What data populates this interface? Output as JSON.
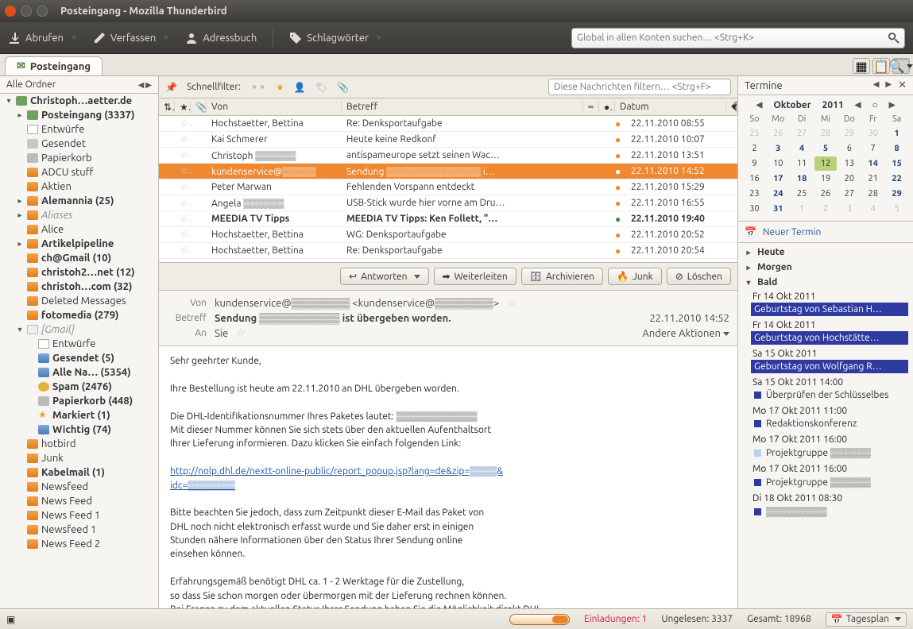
{
  "window": {
    "title": "Posteingang - Mozilla Thunderbird"
  },
  "toolbar": {
    "get": "Abrufen",
    "compose": "Verfassen",
    "addressbook": "Adressbuch",
    "tags": "Schlagwörter",
    "search_ph": "Global in allen Konten suchen… <Strg+K>"
  },
  "tab": {
    "inbox": "Posteingang"
  },
  "sidebar": {
    "header": "Alle Ordner",
    "nodes": [
      {
        "tw": "▾",
        "ico": "inbox",
        "label": "Christoph…aetter.de",
        "bold": true,
        "lvl": 0
      },
      {
        "tw": "▸",
        "ico": "inbox",
        "label": "Posteingang (3337)",
        "bold": true,
        "lvl": 1
      },
      {
        "tw": "",
        "ico": "page",
        "label": "Entwürfe",
        "lvl": 1
      },
      {
        "tw": "",
        "ico": "sent",
        "label": "Gesendet",
        "lvl": 1
      },
      {
        "tw": "",
        "ico": "trash",
        "label": "Papierkorb",
        "lvl": 1
      },
      {
        "tw": "",
        "ico": "folder",
        "label": "ADCU stuff",
        "lvl": 1
      },
      {
        "tw": "",
        "ico": "folder",
        "label": "Aktien",
        "lvl": 1
      },
      {
        "tw": "▸",
        "ico": "folder",
        "label": "Alemannia (25)",
        "bold": true,
        "lvl": 1
      },
      {
        "tw": "▸",
        "ico": "folder",
        "label": "Aliases",
        "grey": true,
        "lvl": 1
      },
      {
        "tw": "",
        "ico": "folder",
        "label": "Alice",
        "lvl": 1
      },
      {
        "tw": "▸",
        "ico": "folder",
        "label": "Artikelpipeline",
        "bold": true,
        "lvl": 1
      },
      {
        "tw": "",
        "ico": "folder",
        "label": "ch@Gmail (10)",
        "bold": true,
        "lvl": 1
      },
      {
        "tw": "",
        "ico": "folder",
        "label": "christoh2…net (12)",
        "bold": true,
        "lvl": 1
      },
      {
        "tw": "",
        "ico": "folder",
        "label": "christoh…com (32)",
        "bold": true,
        "lvl": 1
      },
      {
        "tw": "",
        "ico": "folder",
        "label": "Deleted Messages",
        "lvl": 1
      },
      {
        "tw": "",
        "ico": "folder",
        "label": "fotomedia (279)",
        "bold": true,
        "lvl": 1
      },
      {
        "tw": "▾",
        "ico": "gmail",
        "label": "[Gmail]",
        "grey": true,
        "lvl": 1
      },
      {
        "tw": "",
        "ico": "page",
        "label": "Entwürfe",
        "lvl": 2
      },
      {
        "tw": "",
        "ico": "folder-b",
        "label": "Gesendet (5)",
        "bold": true,
        "lvl": 2
      },
      {
        "tw": "",
        "ico": "folder-b",
        "label": "Alle Na… (5354)",
        "bold": true,
        "lvl": 2
      },
      {
        "tw": "",
        "ico": "spam",
        "label": "Spam (2476)",
        "bold": true,
        "lvl": 2
      },
      {
        "tw": "",
        "ico": "trash",
        "label": "Papierkorb (448)",
        "bold": true,
        "lvl": 2
      },
      {
        "tw": "",
        "ico": "star",
        "label": "Markiert (1)",
        "bold": true,
        "lvl": 2
      },
      {
        "tw": "",
        "ico": "folder-b",
        "label": "Wichtig (74)",
        "bold": true,
        "lvl": 2
      },
      {
        "tw": "",
        "ico": "folder",
        "label": "hotbird",
        "lvl": 1
      },
      {
        "tw": "",
        "ico": "folder",
        "label": "Junk",
        "lvl": 1
      },
      {
        "tw": "",
        "ico": "folder",
        "label": "Kabelmail (1)",
        "bold": true,
        "lvl": 1
      },
      {
        "tw": "",
        "ico": "folder",
        "label": "Newsfeed",
        "lvl": 1
      },
      {
        "tw": "",
        "ico": "folder",
        "label": "News Feed",
        "lvl": 1
      },
      {
        "tw": "",
        "ico": "folder",
        "label": "News Feed 1",
        "lvl": 1
      },
      {
        "tw": "",
        "ico": "folder",
        "label": "Newsfeed 1",
        "lvl": 1
      },
      {
        "tw": "",
        "ico": "folder",
        "label": "News Feed 2",
        "lvl": 1
      }
    ]
  },
  "qfilter": {
    "label": "Schnellfilter:",
    "ph": "Diese Nachrichten filtern… <Strg+F>"
  },
  "columns": {
    "from": "Von",
    "subject": "Betreff",
    "date": "Datum"
  },
  "messages": [
    {
      "from": "Hochstaetter, Bettina",
      "subj": "Re: Denksportaufgabe",
      "date": "22.11.2010 08:55",
      "dot": true
    },
    {
      "from": "Kai Schmerer",
      "subj": "Heute keine Redkonf",
      "date": "22.11.2010 10:07",
      "dot": true
    },
    {
      "from": "Christoph ▒▒▒▒▒▒",
      "subj": "antispameurope setzt seinen Wac…",
      "date": "22.11.2010 13:51",
      "dot": true
    },
    {
      "from": "kundenservice@▒▒▒▒▒",
      "subj": "Sendung ▒▒▒▒▒▒▒▒▒▒▒▒▒▒ i…",
      "date": "22.11.2010 14:52",
      "dot": true,
      "sel": true
    },
    {
      "from": "Peter Marwan",
      "subj": "Fehlenden Vorspann entdeckt",
      "date": "22.11.2010 15:29",
      "dot": true
    },
    {
      "from": "Angela ▒▒▒▒▒▒",
      "subj": "USB-Stick wurde hier vorne am Dru…",
      "date": "22.11.2010 16:55",
      "dot": true
    },
    {
      "from": "MEEDIA TV Tipps",
      "subj": "MEEDIA TV Tipps: Ken Follett, \"…",
      "date": "22.11.2010 19:40",
      "dot": true,
      "green": true,
      "bold": true
    },
    {
      "from": "Hochstaetter, Bettina",
      "subj": "WG: Denksportaufgabe",
      "date": "22.11.2010 20:52",
      "dot": true
    },
    {
      "from": "Hochstaetter, Bettina",
      "subj": "Re: Denksportaufgabe",
      "date": "22.11.2010 20:54",
      "dot": true
    }
  ],
  "actions": {
    "reply": "Antworten",
    "fwd": "Weiterleiten",
    "arch": "Archivieren",
    "junk": "Junk",
    "del": "Löschen"
  },
  "reader": {
    "from_lbl": "Von",
    "from_val": "kundenservice@▒▒▒▒▒▒▒▒ <kundenservice@▒▒▒▒▒▒▒▒>",
    "subj_lbl": "Betreff",
    "subj_val": "Sendung ▒▒▒▒▒▒▒▒▒▒▒ ist übergeben worden.",
    "to_lbl": "An",
    "to_val": "Sie",
    "other": "Andere Aktionen",
    "date": "22.11.2010 14:52",
    "body": "Sehr geehrter Kunde,\n\nIhre Bestellung ist heute am 22.11.2010 an DHL übergeben worden.\n\nDie DHL-Identifikationsnummer Ihres Paketes lautet: ▒▒▒▒▒▒▒▒▒▒▒▒\nMit dieser Nummer können Sie sich stets über den aktuellen Aufenthaltsort\nIhrer Lieferung informieren. Dazu klicken Sie einfach folgenden Link:\n\n",
    "link": "http://nolp.dhl.de/nextt-online-public/report_popup.jsp?lang=de&zip=▒▒▒▒&\nidc=▒▒▒▒▒▒▒",
    "body2": "\n\nBitte beachten Sie jedoch, dass zum Zeitpunkt dieser E-Mail das Paket von\nDHL noch nicht elektronisch erfasst wurde und Sie daher erst in einigen\nStunden nähere Informationen über den Status Ihrer Sendung online\neinsehen können.\n\nErfahrungsgemäß benötigt DHL ca. 1 - 2 Werktage für die Zustellung,\nso dass Sie schon morgen oder übermorgen mit der Lieferung rechnen können.\nBei Fragen zu dem aktuellen Status Ihrer Sendung haben Sie die Möglichkeit direkt DHL"
  },
  "cal": {
    "title": "Termine",
    "month": "Oktober",
    "year": "2011",
    "dh": [
      "So",
      "Mo",
      "Di",
      "Mi",
      "Do",
      "Fr",
      "Sa"
    ],
    "weeks": [
      [
        {
          "n": 25,
          "out": true
        },
        {
          "n": 26,
          "out": true
        },
        {
          "n": 27,
          "out": true
        },
        {
          "n": 28,
          "out": true
        },
        {
          "n": 29,
          "out": true
        },
        {
          "n": 30,
          "out": true
        },
        {
          "n": 1,
          "b": true
        }
      ],
      [
        {
          "n": 2
        },
        {
          "n": 3,
          "b": true
        },
        {
          "n": 4,
          "b": true
        },
        {
          "n": 5,
          "b": true
        },
        {
          "n": 6
        },
        {
          "n": 7
        },
        {
          "n": 8,
          "b": true
        }
      ],
      [
        {
          "n": 9
        },
        {
          "n": 10
        },
        {
          "n": 11
        },
        {
          "n": 12,
          "today": true
        },
        {
          "n": 13
        },
        {
          "n": 14,
          "b": true
        },
        {
          "n": 15,
          "b": true
        }
      ],
      [
        {
          "n": 16
        },
        {
          "n": 17,
          "b": true
        },
        {
          "n": 18,
          "b": true
        },
        {
          "n": 19
        },
        {
          "n": 20
        },
        {
          "n": 21
        },
        {
          "n": 22,
          "b": true
        }
      ],
      [
        {
          "n": 23
        },
        {
          "n": 24,
          "b": true
        },
        {
          "n": 25
        },
        {
          "n": 26
        },
        {
          "n": 27
        },
        {
          "n": 28
        },
        {
          "n": 29,
          "b": true
        }
      ],
      [
        {
          "n": 30
        },
        {
          "n": 31,
          "b": true
        },
        {
          "n": 1,
          "out": true
        },
        {
          "n": 2,
          "out": true
        },
        {
          "n": 3,
          "out": true
        },
        {
          "n": 4,
          "out": true
        },
        {
          "n": 5,
          "out": true
        }
      ]
    ],
    "newterm": "Neuer Termin",
    "sections": {
      "today": "Heute",
      "tomorrow": "Morgen",
      "soon": "Bald"
    },
    "events": [
      {
        "d": "Fr 14 Okt 2011",
        "t": "Geburtstag von Sebastian H…",
        "hi": true
      },
      {
        "d": "Fr 14 Okt 2011",
        "t": "Geburtstag von Hochstätte…",
        "hi": true
      },
      {
        "d": "Sa 15 Okt 2011",
        "t": "Geburtstag von Wolfgang R…",
        "hi": true
      },
      {
        "d": "Sa 15 Okt 2011 14:00",
        "t": "Überprüfen der Schlüsselbes",
        "c": "#2f3aa0"
      },
      {
        "d": "Mo 17 Okt 2011 11:00",
        "t": "Redaktionskonferenz",
        "c": "#2f3aa0"
      },
      {
        "d": "Mo 17 Okt 2011 16:00",
        "t": "Projektgruppe ▒▒▒▒▒▒",
        "c": "#b9d3ee"
      },
      {
        "d": "Mo 17 Okt 2011 16:00",
        "t": "Projektgruppe ▒▒▒▒▒▒",
        "c": "#2f3aa0"
      },
      {
        "d": "Di 18 Okt 2011 08:30",
        "t": "▒▒▒▒▒▒▒▒▒",
        "c": "#2f3aa0"
      }
    ]
  },
  "status": {
    "inv": "Einladungen: 1",
    "unread": "Ungelesen: 3337",
    "total": "Gesamt: 18968",
    "dayplan": "Tagesplan"
  }
}
